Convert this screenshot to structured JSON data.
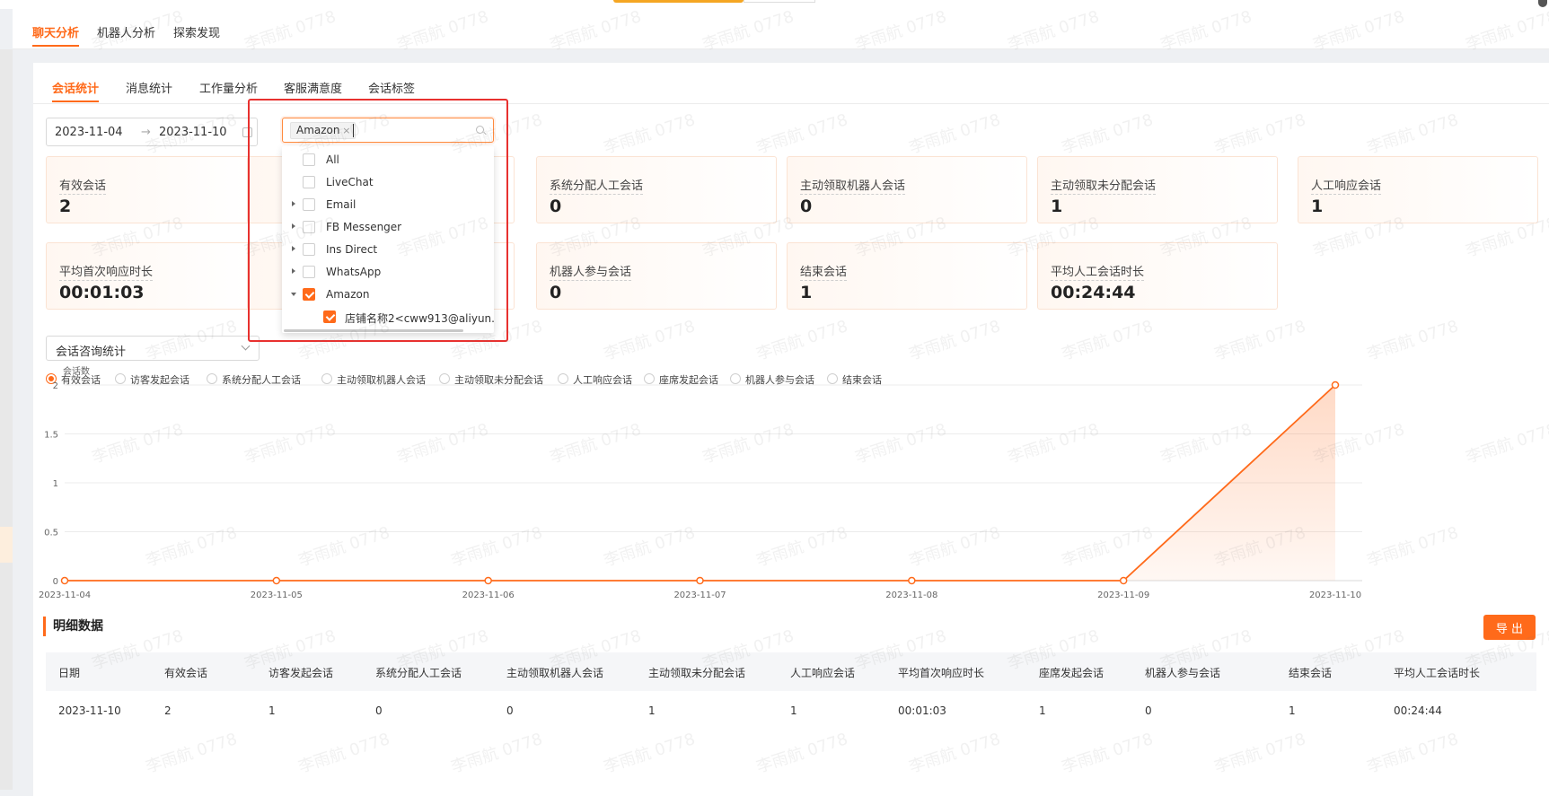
{
  "main_tabs": [
    {
      "label": "聊天分析",
      "active": true
    },
    {
      "label": "机器人分析",
      "active": false
    },
    {
      "label": "探索发现",
      "active": false
    }
  ],
  "sub_tabs": [
    {
      "label": "会话统计",
      "active": true
    },
    {
      "label": "消息统计",
      "active": false
    },
    {
      "label": "工作量分析",
      "active": false
    },
    {
      "label": "客服满意度",
      "active": false
    },
    {
      "label": "会话标签",
      "active": false
    }
  ],
  "date_range": {
    "start": "2023-11-04",
    "separator": "→",
    "end": "2023-11-10"
  },
  "channel_filter": {
    "selected_tag": "Amazon",
    "tag_close": "×"
  },
  "channel_options": [
    {
      "label": "All",
      "checked": false,
      "expandable": false,
      "expanded": false,
      "level": 0
    },
    {
      "label": "LiveChat",
      "checked": false,
      "expandable": false,
      "expanded": false,
      "level": 0
    },
    {
      "label": "Email",
      "checked": false,
      "expandable": true,
      "expanded": false,
      "level": 0
    },
    {
      "label": "FB Messenger",
      "checked": false,
      "expandable": true,
      "expanded": false,
      "level": 0
    },
    {
      "label": "Ins Direct",
      "checked": false,
      "expandable": true,
      "expanded": false,
      "level": 0
    },
    {
      "label": "WhatsApp",
      "checked": false,
      "expandable": true,
      "expanded": false,
      "level": 0
    },
    {
      "label": "Amazon",
      "checked": true,
      "expandable": true,
      "expanded": true,
      "level": 0
    },
    {
      "label": "店铺名称2<cww913@aliyun.",
      "checked": true,
      "expandable": false,
      "expanded": false,
      "level": 1
    }
  ],
  "stats_row1": [
    {
      "label": "有效会话",
      "value": "2"
    },
    {
      "label": "系统分配人工会话",
      "value": "0"
    },
    {
      "label": "主动领取机器人会话",
      "value": "0"
    },
    {
      "label": "主动领取未分配会话",
      "value": "1"
    },
    {
      "label": "人工响应会话",
      "value": "1"
    }
  ],
  "stats_row2": [
    {
      "label": "平均首次响应时长",
      "value": "00:01:03"
    },
    {
      "label": "机器人参与会话",
      "value": "0"
    },
    {
      "label": "结束会话",
      "value": "1"
    },
    {
      "label": "平均人工会话时长",
      "value": "00:24:44"
    }
  ],
  "chart_select": {
    "value": "会话咨询统计"
  },
  "metric_radios": [
    {
      "label": "有效会话",
      "selected": true
    },
    {
      "label": "访客发起会话",
      "selected": false
    },
    {
      "label": "系统分配人工会话",
      "selected": false
    },
    {
      "label": "主动领取机器人会话",
      "selected": false
    },
    {
      "label": "主动领取未分配会话",
      "selected": false
    },
    {
      "label": "人工响应会话",
      "selected": false
    },
    {
      "label": "座席发起会话",
      "selected": false
    },
    {
      "label": "机器人参与会话",
      "selected": false
    },
    {
      "label": "结束会话",
      "selected": false
    }
  ],
  "chart_data": {
    "type": "area",
    "ylabel": "会话数",
    "x": [
      "2023-11-04",
      "2023-11-05",
      "2023-11-06",
      "2023-11-07",
      "2023-11-08",
      "2023-11-09",
      "2023-11-10"
    ],
    "series": [
      {
        "values": [
          0,
          0,
          0,
          0,
          0,
          0,
          2
        ]
      }
    ],
    "yticks": [
      "0",
      "0.5",
      "1",
      "1.5",
      "2"
    ],
    "ylim": [
      0,
      2
    ],
    "grid": true,
    "color": "#ff6a1a"
  },
  "detail": {
    "title": "明细数据",
    "export_label": "导 出"
  },
  "table": {
    "headers": [
      "日期",
      "有效会话",
      "访客发起会话",
      "系统分配人工会话",
      "主动领取机器人会话",
      "主动领取未分配会话",
      "人工响应会话",
      "平均首次响应时长",
      "座席发起会话",
      "机器人参与会话",
      "结束会话",
      "平均人工会话时长"
    ],
    "rows": [
      [
        "2023-11-10",
        "2",
        "1",
        "0",
        "0",
        "1",
        "1",
        "00:01:03",
        "1",
        "0",
        "1",
        "00:24:44"
      ]
    ]
  },
  "watermark": "李雨航 0778",
  "colors": {
    "accent": "#ff6a1a",
    "highlight": "#e8312f"
  }
}
